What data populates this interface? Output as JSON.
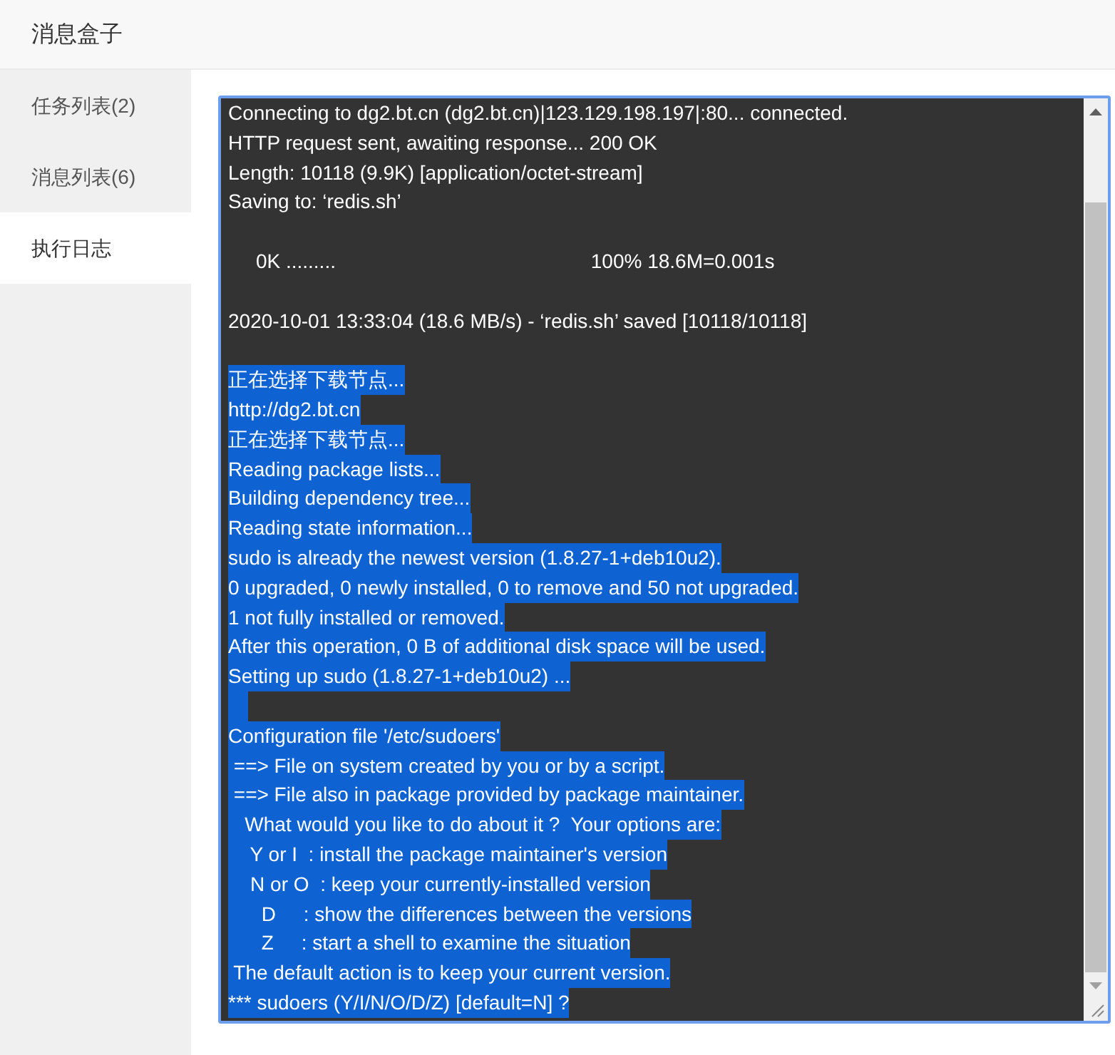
{
  "window": {
    "title": "消息盒子"
  },
  "sidebar": {
    "items": [
      {
        "label": "任务列表(2)",
        "selected": false
      },
      {
        "label": "消息列表(6)",
        "selected": false
      },
      {
        "label": "执行日志",
        "selected": true
      }
    ]
  },
  "log": {
    "lines": [
      {
        "kind": "text",
        "text": "Connecting to dg2.bt.cn (dg2.bt.cn)|123.129.198.197|:80... connected.",
        "selected": false
      },
      {
        "kind": "text",
        "text": "HTTP request sent, awaiting response... 200 OK",
        "selected": false
      },
      {
        "kind": "text",
        "text": "Length: 10118 (9.9K) [application/octet-stream]",
        "selected": false
      },
      {
        "kind": "text",
        "text": "Saving to: ‘redis.sh’",
        "selected": false
      },
      {
        "kind": "blank",
        "selected": false
      },
      {
        "kind": "text",
        "text": "     0K .........                                              100% 18.6M=0.001s",
        "selected": false
      },
      {
        "kind": "blank",
        "selected": false
      },
      {
        "kind": "text",
        "text": "2020-10-01 13:33:04 (18.6 MB/s) - ‘redis.sh’ saved [10118/10118]",
        "selected": false
      },
      {
        "kind": "blank",
        "selected": false
      },
      {
        "kind": "text",
        "text": "正在选择下载节点...",
        "selected": true
      },
      {
        "kind": "text",
        "text": "http://dg2.bt.cn",
        "selected": true
      },
      {
        "kind": "text",
        "text": "正在选择下载节点...",
        "selected": true
      },
      {
        "kind": "text",
        "text": "Reading package lists...",
        "selected": true
      },
      {
        "kind": "text",
        "text": "Building dependency tree...",
        "selected": true
      },
      {
        "kind": "text",
        "text": "Reading state information...",
        "selected": true
      },
      {
        "kind": "text",
        "text": "sudo is already the newest version (1.8.27-1+deb10u2).",
        "selected": true
      },
      {
        "kind": "text",
        "text": "0 upgraded, 0 newly installed, 0 to remove and 50 not upgraded.",
        "selected": true
      },
      {
        "kind": "text",
        "text": "1 not fully installed or removed.",
        "selected": true
      },
      {
        "kind": "text",
        "text": "After this operation, 0 B of additional disk space will be used.",
        "selected": true
      },
      {
        "kind": "text",
        "text": "Setting up sudo (1.8.27-1+deb10u2) ...",
        "selected": true
      },
      {
        "kind": "blank",
        "selected": true
      },
      {
        "kind": "text",
        "text": "Configuration file '/etc/sudoers'",
        "selected": true
      },
      {
        "kind": "text",
        "text": " ==> File on system created by you or by a script.",
        "selected": true
      },
      {
        "kind": "text",
        "text": " ==> File also in package provided by package maintainer.",
        "selected": true
      },
      {
        "kind": "text",
        "text": "   What would you like to do about it ?  Your options are:",
        "selected": true
      },
      {
        "kind": "text",
        "text": "    Y or I  : install the package maintainer's version",
        "selected": true
      },
      {
        "kind": "text",
        "text": "    N or O  : keep your currently-installed version",
        "selected": true
      },
      {
        "kind": "text",
        "text": "      D     : show the differences between the versions",
        "selected": true
      },
      {
        "kind": "text",
        "text": "      Z     : start a shell to examine the situation",
        "selected": true
      },
      {
        "kind": "text",
        "text": " The default action is to keep your current version.",
        "selected": true
      },
      {
        "kind": "text",
        "text": "*** sudoers (Y/I/N/O/D/Z) [default=N] ?",
        "selected": true
      }
    ]
  }
}
